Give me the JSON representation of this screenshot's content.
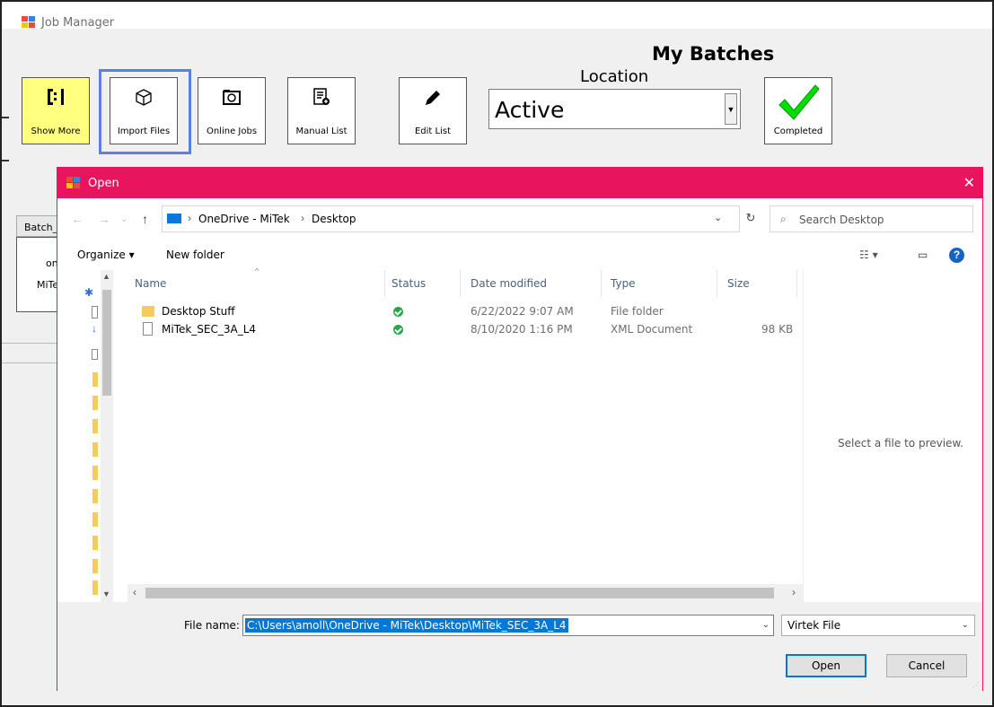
{
  "main_window": {
    "title": "Job Manager",
    "heading": "My Batches",
    "location_label": "Location",
    "location_value": "Active",
    "toolbar": {
      "show_more": "Show More",
      "import_files": "Import Files",
      "online_jobs": "Online Jobs",
      "manual_list": "Manual List",
      "edit_list": "Edit List",
      "completed": "Completed"
    },
    "batch_panel": {
      "tab_label": "Batch_",
      "cells": [
        "one",
        "MiTe"
      ]
    }
  },
  "open_dialog": {
    "title": "Open",
    "breadcrumb": [
      "OneDrive - MiTek",
      "Desktop"
    ],
    "search_placeholder": "Search Desktop",
    "commands": {
      "organize": "Organize ▾",
      "new_folder": "New folder"
    },
    "columns": [
      "Name",
      "Status",
      "Date modified",
      "Type",
      "Size"
    ],
    "files": [
      {
        "name": "Desktop Stuff",
        "status": "synced",
        "date": "6/22/2022 9:07 AM",
        "type": "File folder",
        "size": ""
      },
      {
        "name": "MiTek_SEC_3A_L4",
        "status": "synced",
        "date": "8/10/2020 1:16 PM",
        "type": "XML Document",
        "size": "98 KB"
      }
    ],
    "preview_text": "Select a file to preview.",
    "file_name_label": "File name:",
    "file_name_value": "C:\\Users\\amoll\\OneDrive - MiTek\\Desktop\\MiTek_SEC_3A_L4",
    "file_type": "Virtek File",
    "open_label": "Open",
    "cancel_label": "Cancel"
  },
  "colors": {
    "dialog_accent": "#e8145d",
    "show_more_bg": "#ffff80",
    "focus_border": "#5b7ee8",
    "selection": "#0078d7",
    "check_green": "#28a745"
  }
}
